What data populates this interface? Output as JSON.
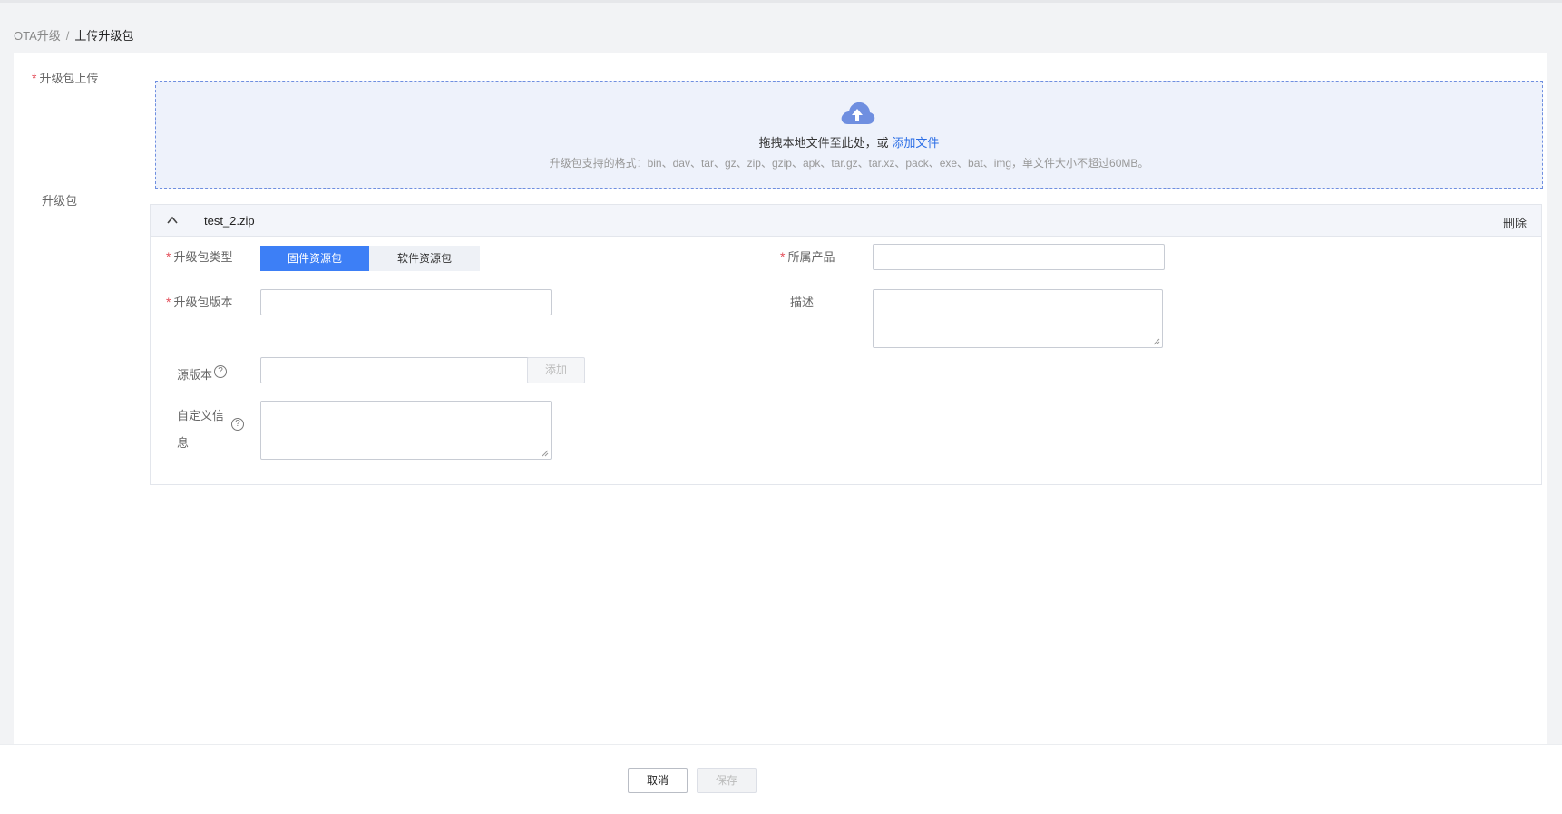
{
  "breadcrumb": {
    "parent": "OTA升级",
    "separator": "/",
    "current": "上传升级包"
  },
  "upload": {
    "label": "升级包上传",
    "drop_text": "拖拽本地文件至此处，或",
    "add_link": "添加文件",
    "hint": "升级包支持的格式：bin、dav、tar、gz、zip、gzip、apk、tar.gz、tar.xz、pack、exe、bat、img，单文件大小不超过60MB。",
    "icon": "cloud-upload-icon"
  },
  "package": {
    "label": "升级包",
    "file_name": "test_2.zip",
    "delete_label": "删除",
    "type_label": "升级包类型",
    "type_options": [
      "固件资源包",
      "软件资源包"
    ],
    "type_selected": "固件资源包",
    "product_label": "所属产品",
    "version_label": "升级包版本",
    "desc_label": "描述",
    "source_version_label": "源版本",
    "add_label": "添加",
    "custom_info_label": "自定义信息",
    "help_glyph": "?"
  },
  "footer": {
    "cancel_label": "取消",
    "save_label": "保存"
  },
  "colors": {
    "primary": "#3d7ff6",
    "link": "#2b6ee6",
    "required": "#e34d59"
  },
  "required_mark": "*"
}
